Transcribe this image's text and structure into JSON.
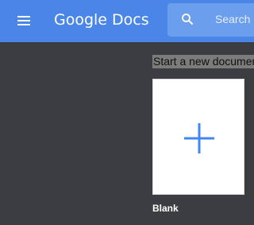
{
  "header": {
    "app_title": "Google Docs",
    "menu_icon": "hamburger-menu-icon",
    "brand_color": "#4a86e8"
  },
  "search": {
    "placeholder": "Search",
    "value": "",
    "icon": "search-icon"
  },
  "templates": {
    "section_heading": "Start a new document",
    "items": [
      {
        "label": "Blank",
        "icon": "plus-icon",
        "accent_color": "#4285f4"
      }
    ]
  },
  "colors": {
    "background": "#3c3d40",
    "search_background": "#6b9eed"
  }
}
